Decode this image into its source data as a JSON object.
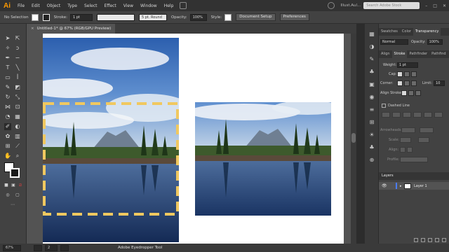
{
  "app": {
    "logo": "Ai",
    "menu": [
      "File",
      "Edit",
      "Object",
      "Type",
      "Select",
      "Effect",
      "View",
      "Window",
      "Help"
    ],
    "workspace": "Illust.Aul...",
    "search_placeholder": "Search Adobe Stock"
  },
  "control_bar": {
    "selection": "No Selection",
    "stroke_label": "Stroke:",
    "stroke_value": "1 pt",
    "brush": "5 pt. Round",
    "opacity_label": "Opacity:",
    "opacity_value": "100%",
    "style_label": "Style:",
    "document_setup": "Document Setup",
    "preferences": "Preferences"
  },
  "document": {
    "tab_title": "Untitled-1* @ 67% (RGB/GPU Preview)",
    "close": "×"
  },
  "statusbar": {
    "zoom": "67%",
    "artboard": "2",
    "current_tool": "Adobe Eyedropper Tool"
  },
  "panels": {
    "top_tabs": [
      "Swatches",
      "Color",
      "Transparency"
    ],
    "blend_mode": "Normal",
    "opacity_label": "Opacity:",
    "opacity_value": "100%",
    "stroke_tabs": [
      "Align",
      "Stroke",
      "Pathfinder",
      "Pathfind"
    ],
    "weight_label": "Weight:",
    "weight_value": "1 pt",
    "cap_label": "Cap:",
    "corner_label": "Corner:",
    "limit_label": "Limit:",
    "limit_value": "10",
    "align_stroke_label": "Align Stroke:",
    "dashed_line": "Dashed Line",
    "arrowheads_label": "Arrowheads:",
    "scale_label": "Scale:",
    "align_label": "Align:",
    "profile_label": "Profile:",
    "layers_title": "Layers",
    "layer_name": "Layer 1"
  },
  "colors": {
    "accent": "#ff9a00",
    "dash": "#f0c860",
    "sky": "#3f6fb5",
    "water": "#1f3c70"
  }
}
